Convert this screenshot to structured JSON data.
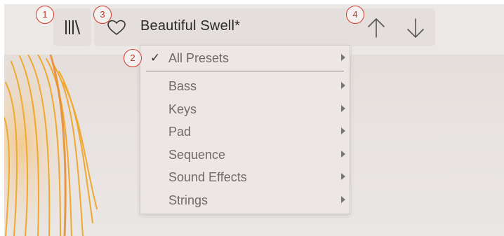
{
  "toolbar": {
    "library_icon": "library-icon",
    "favorite_icon": "heart-icon",
    "preset_name": "Beautiful Swell*",
    "prev_icon": "arrow-up-icon",
    "next_icon": "arrow-down-icon"
  },
  "menu": {
    "checkmark": "✓",
    "items": [
      {
        "label": "All Presets",
        "checked": true
      },
      {
        "label": "Bass"
      },
      {
        "label": "Keys"
      },
      {
        "label": "Pad"
      },
      {
        "label": "Sequence"
      },
      {
        "label": "Sound Effects"
      },
      {
        "label": "Strings"
      }
    ]
  },
  "callouts": [
    "1",
    "2",
    "3",
    "4"
  ],
  "colors": {
    "callout": "#d63a2c",
    "artwork": "#f0a830"
  }
}
